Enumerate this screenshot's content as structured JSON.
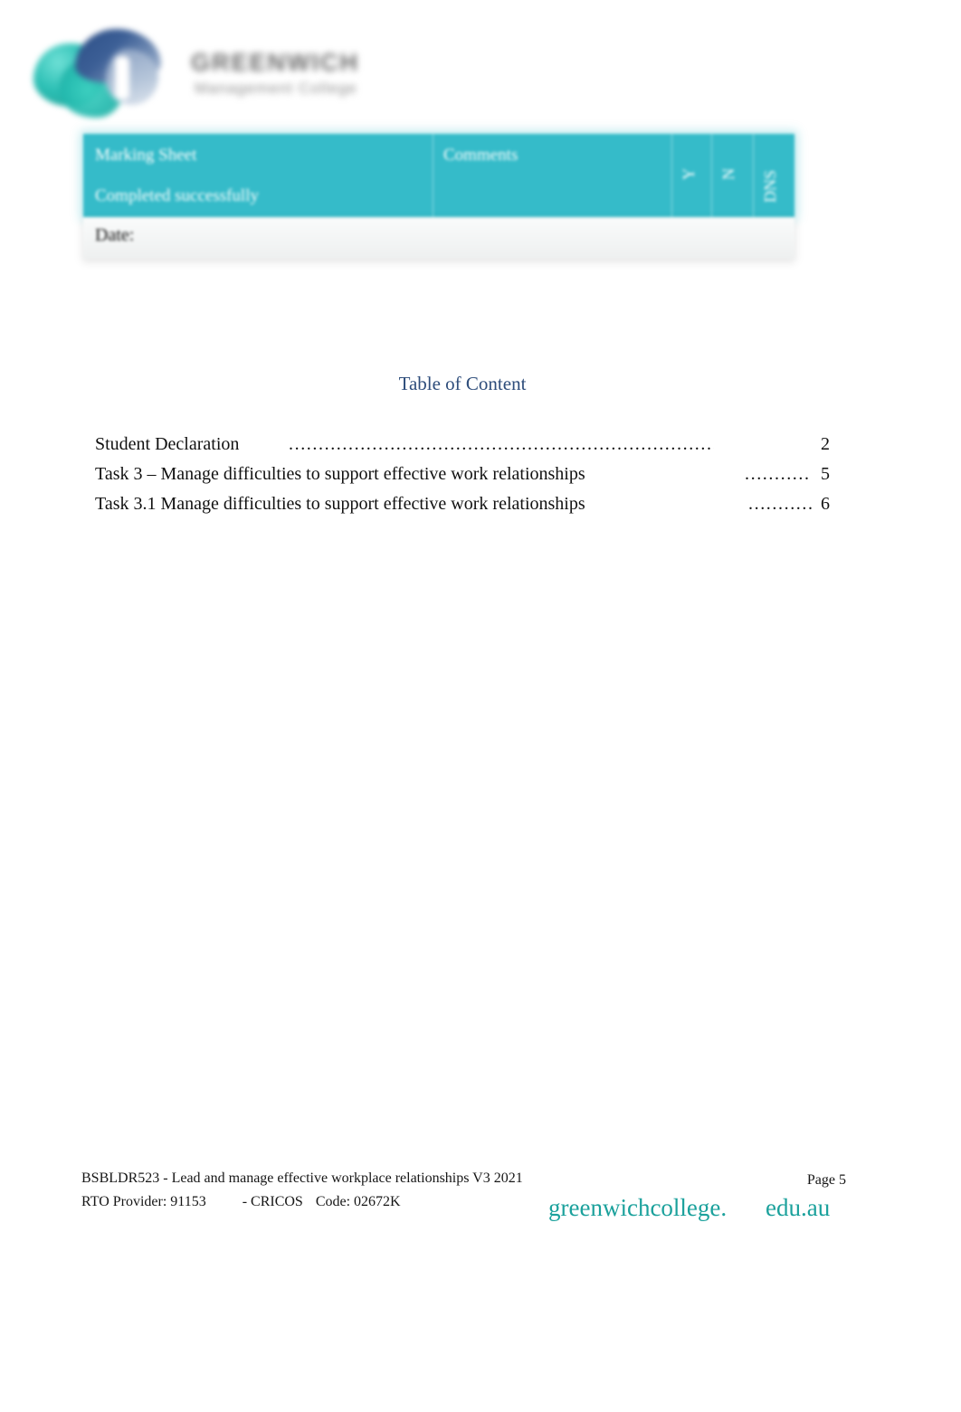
{
  "header": {
    "logo_icon": "greenwich-gm-monogram-logo",
    "brand_name": "GREENWICH",
    "brand_tagline": "Management College"
  },
  "marking_sheet": {
    "columns": {
      "criteria": "Marking Sheet",
      "comments": "Comments",
      "yes": "Y",
      "no": "N",
      "dns": "DNS"
    },
    "rows": [
      {
        "criteria": "Completed successfully",
        "comments": "",
        "yes": "",
        "no": "",
        "dns": ""
      }
    ],
    "date_label": "Date:",
    "date_value": "",
    "header_color": "#35bbc9"
  },
  "toc": {
    "title": "Table of Content",
    "title_color": "#2e4d7b",
    "entries": [
      {
        "label": "Student Declaration",
        "leader": "..............................................................................................",
        "page": "2"
      },
      {
        "label": "Task 3 – Manage difficulties to support effective work relationships",
        "leader": "............",
        "page": "5"
      },
      {
        "label": "Task 3.1 Manage difficulties to support effective work relationships",
        "leader": "............",
        "page": "6"
      }
    ]
  },
  "footer": {
    "unit_line": "BSBLDR523 - Lead and manage effective workplace relationships V3 2021",
    "rto_label": "RTO Provider: 91153",
    "cricos_label": "- CRICOS",
    "cricos_code": "Code: 02672K",
    "page_number": "Page 5",
    "url_main": "greenwichcollege.",
    "url_tld": "edu.au",
    "url_color": "#1ba19c"
  }
}
